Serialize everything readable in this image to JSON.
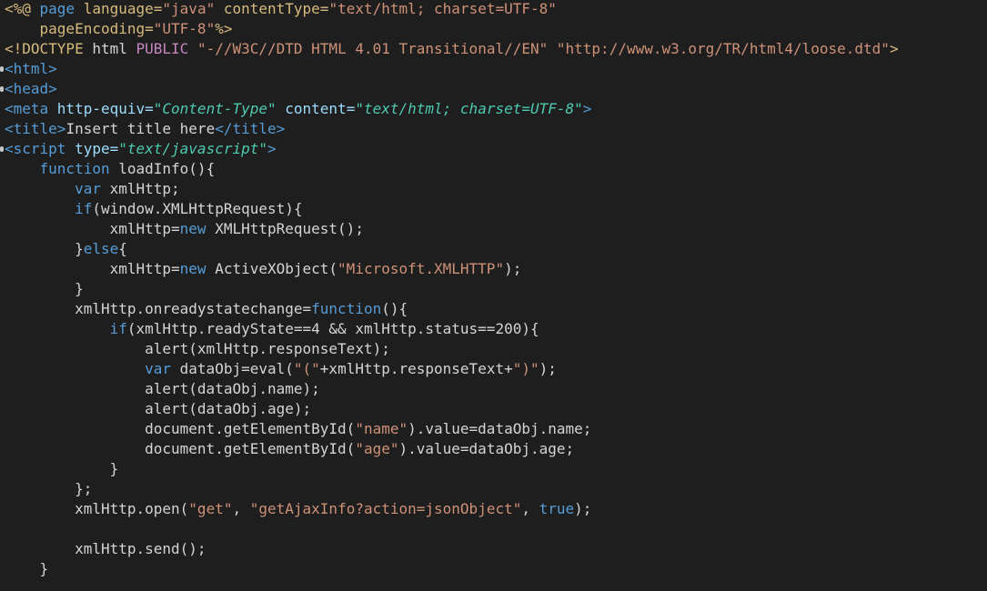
{
  "editor": {
    "background": "#1e1e1e",
    "colors": {
      "plain": "#d4d4d4",
      "keyword": "#569cd6",
      "attribute": "#9cdcfe",
      "string": "#ce9178",
      "attr_value_italic": "#4ec9b0",
      "tag": "#569cd6",
      "directive": "#d7ba7d",
      "number": "#b5cea8",
      "public": "#c586c0"
    },
    "lines": [
      {
        "fold": false,
        "tokens": [
          {
            "t": "<%@ ",
            "c": "directive"
          },
          {
            "t": "page ",
            "c": "kw"
          },
          {
            "t": "language=",
            "c": "directive"
          },
          {
            "t": "\"java\" ",
            "c": "str"
          },
          {
            "t": "contentType=",
            "c": "directive"
          },
          {
            "t": "\"text/html; charset=UTF-8\"",
            "c": "str"
          }
        ]
      },
      {
        "fold": false,
        "tokens": [
          {
            "t": "    pageEncoding=",
            "c": "directive"
          },
          {
            "t": "\"UTF-8\"",
            "c": "str"
          },
          {
            "t": "%>",
            "c": "directive"
          }
        ]
      },
      {
        "fold": false,
        "tokens": [
          {
            "t": "<!DOCTYPE ",
            "c": "doctype"
          },
          {
            "t": "html ",
            "c": "plain"
          },
          {
            "t": "PUBLIC ",
            "c": "public"
          },
          {
            "t": "\"-//W3C//DTD HTML 4.01 Transitional//EN\" ",
            "c": "dtd"
          },
          {
            "t": "\"http://www.w3.org/TR/html4/loose.dtd\"",
            "c": "dtd"
          },
          {
            "t": ">",
            "c": "doctype"
          }
        ]
      },
      {
        "fold": true,
        "tokens": [
          {
            "t": "<html>",
            "c": "tag"
          }
        ]
      },
      {
        "fold": true,
        "tokens": [
          {
            "t": "<head>",
            "c": "tag"
          }
        ]
      },
      {
        "fold": false,
        "tokens": [
          {
            "t": "<meta ",
            "c": "tag"
          },
          {
            "t": "http-equiv=",
            "c": "attr"
          },
          {
            "t": "\"Content-Type\" ",
            "c": "stri"
          },
          {
            "t": "content=",
            "c": "attr"
          },
          {
            "t": "\"text/html; charset=UTF-8\"",
            "c": "stri"
          },
          {
            "t": ">",
            "c": "tag"
          }
        ]
      },
      {
        "fold": false,
        "tokens": [
          {
            "t": "<title>",
            "c": "tag"
          },
          {
            "t": "Insert title here",
            "c": "plain"
          },
          {
            "t": "</title>",
            "c": "tag"
          }
        ]
      },
      {
        "fold": true,
        "tokens": [
          {
            "t": "<script ",
            "c": "tag"
          },
          {
            "t": "type=",
            "c": "attr"
          },
          {
            "t": "\"text/javascript\"",
            "c": "stri"
          },
          {
            "t": ">",
            "c": "tag"
          }
        ]
      },
      {
        "fold": false,
        "tokens": [
          {
            "t": "    ",
            "c": "plain"
          },
          {
            "t": "function ",
            "c": "kw"
          },
          {
            "t": "loadInfo(){",
            "c": "plain"
          }
        ]
      },
      {
        "fold": false,
        "tokens": [
          {
            "t": "        ",
            "c": "plain"
          },
          {
            "t": "var ",
            "c": "kw"
          },
          {
            "t": "xmlHttp;",
            "c": "plain"
          }
        ]
      },
      {
        "fold": false,
        "tokens": [
          {
            "t": "        ",
            "c": "plain"
          },
          {
            "t": "if",
            "c": "kw"
          },
          {
            "t": "(window.XMLHttpRequest){",
            "c": "plain"
          }
        ]
      },
      {
        "fold": false,
        "tokens": [
          {
            "t": "            xmlHttp=",
            "c": "plain"
          },
          {
            "t": "new ",
            "c": "kw"
          },
          {
            "t": "XMLHttpRequest();",
            "c": "plain"
          }
        ]
      },
      {
        "fold": false,
        "tokens": [
          {
            "t": "        }",
            "c": "plain"
          },
          {
            "t": "else",
            "c": "kw"
          },
          {
            "t": "{",
            "c": "plain"
          }
        ]
      },
      {
        "fold": false,
        "tokens": [
          {
            "t": "            xmlHttp=",
            "c": "plain"
          },
          {
            "t": "new ",
            "c": "kw"
          },
          {
            "t": "ActiveXObject(",
            "c": "plain"
          },
          {
            "t": "\"Microsoft.XMLHTTP\"",
            "c": "str"
          },
          {
            "t": ");",
            "c": "plain"
          }
        ]
      },
      {
        "fold": false,
        "tokens": [
          {
            "t": "        }",
            "c": "plain"
          }
        ]
      },
      {
        "fold": false,
        "tokens": [
          {
            "t": "        xmlHttp.onreadystatechange=",
            "c": "plain"
          },
          {
            "t": "function",
            "c": "kw"
          },
          {
            "t": "(){",
            "c": "plain"
          }
        ]
      },
      {
        "fold": false,
        "tokens": [
          {
            "t": "            ",
            "c": "plain"
          },
          {
            "t": "if",
            "c": "kw"
          },
          {
            "t": "(xmlHttp.readyState==4 && xmlHttp.status==200){",
            "c": "plain"
          }
        ]
      },
      {
        "fold": false,
        "tokens": [
          {
            "t": "                alert(xmlHttp.responseText);",
            "c": "plain"
          }
        ]
      },
      {
        "fold": false,
        "tokens": [
          {
            "t": "                ",
            "c": "plain"
          },
          {
            "t": "var ",
            "c": "kw"
          },
          {
            "t": "dataObj=eval(",
            "c": "plain"
          },
          {
            "t": "\"(\"",
            "c": "str"
          },
          {
            "t": "+xmlHttp.responseText+",
            "c": "plain"
          },
          {
            "t": "\")\"",
            "c": "str"
          },
          {
            "t": ");",
            "c": "plain"
          }
        ]
      },
      {
        "fold": false,
        "tokens": [
          {
            "t": "                alert(dataObj.name);",
            "c": "plain"
          }
        ]
      },
      {
        "fold": false,
        "tokens": [
          {
            "t": "                alert(dataObj.age);",
            "c": "plain"
          }
        ]
      },
      {
        "fold": false,
        "tokens": [
          {
            "t": "                document.getElementById(",
            "c": "plain"
          },
          {
            "t": "\"name\"",
            "c": "str"
          },
          {
            "t": ").value=dataObj.name;",
            "c": "plain"
          }
        ]
      },
      {
        "fold": false,
        "tokens": [
          {
            "t": "                document.getElementById(",
            "c": "plain"
          },
          {
            "t": "\"age\"",
            "c": "str"
          },
          {
            "t": ").value=dataObj.age;",
            "c": "plain"
          }
        ]
      },
      {
        "fold": false,
        "tokens": [
          {
            "t": "            }",
            "c": "plain"
          }
        ]
      },
      {
        "fold": false,
        "tokens": [
          {
            "t": "        };",
            "c": "plain"
          }
        ]
      },
      {
        "fold": false,
        "tokens": [
          {
            "t": "        xmlHttp.open(",
            "c": "plain"
          },
          {
            "t": "\"get\"",
            "c": "str"
          },
          {
            "t": ", ",
            "c": "plain"
          },
          {
            "t": "\"getAjaxInfo?action=jsonObject\"",
            "c": "str"
          },
          {
            "t": ", ",
            "c": "plain"
          },
          {
            "t": "true",
            "c": "kw"
          },
          {
            "t": ");",
            "c": "plain"
          }
        ]
      },
      {
        "fold": false,
        "tokens": []
      },
      {
        "fold": false,
        "tokens": [
          {
            "t": "        xmlHttp.send();",
            "c": "plain"
          }
        ]
      },
      {
        "fold": false,
        "tokens": [
          {
            "t": "    }",
            "c": "plain"
          }
        ]
      }
    ]
  }
}
